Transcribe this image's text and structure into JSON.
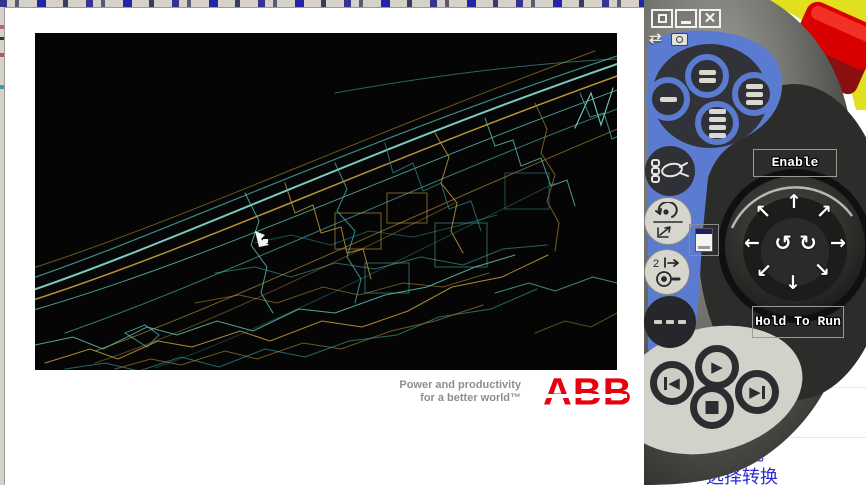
{
  "splash": {
    "tagline_line1": "Power and productivity",
    "tagline_line2": "for a better world™",
    "logo_text": "ABB"
  },
  "pendant": {
    "enable_label": "Enable",
    "hold_to_run_label": "Hold To Run",
    "window_controls": {
      "close_glyph": "✕"
    },
    "icons": {
      "swap": "⇄",
      "arrow_up": "↑",
      "arrow_down": "↓",
      "arrow_left": "←",
      "arrow_right": "→",
      "arrow_up_left": "↖",
      "arrow_up_right": "↗",
      "arrow_down_left": "↙",
      "arrow_down_right": "↘",
      "rotate_ccw": "↺",
      "rotate_cw": "↻",
      "play": "▶",
      "stop": "■",
      "step_back": "◀",
      "step_forward": "▶"
    }
  },
  "background_page": {
    "fragment_line1": "激光",
    "fragment_line2": "选择转换"
  },
  "colors": {
    "abb_red": "#e8000d",
    "pendant_blue": "#5b7bd0",
    "estop_red": "#d90000",
    "housing_yellow": "#e2e01e",
    "line_teal": "#5fc0b4",
    "line_gold": "#c5a23d"
  }
}
